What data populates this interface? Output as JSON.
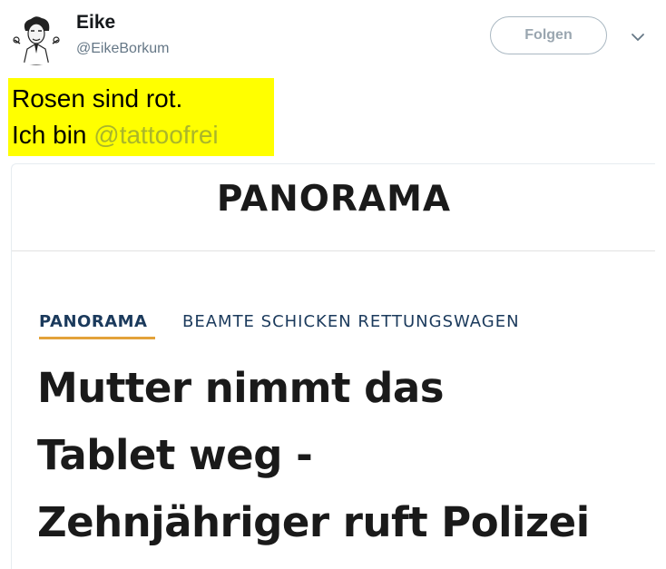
{
  "user": {
    "display_name": "Eike",
    "handle": "@EikeBorkum",
    "avatar_icon": "cartoon-avatar-icon"
  },
  "follow_label": "Folgen",
  "tweet": {
    "line1": "Rosen sind rot.",
    "line2_prefix": "Ich bin ",
    "mention": "@tattoofrei",
    "highlight_color": "#ffff00"
  },
  "card": {
    "logo": "PANORAMA",
    "section": "PANORAMA",
    "kicker": "BEAMTE SCHICKEN RETTUNGSWAGEN",
    "headline_lines": [
      "Mutter nimmt das",
      "Tablet weg -",
      "Zehnjähriger ruft Polizei"
    ]
  },
  "colors": {
    "section_accent": "#e3a23a",
    "section_text": "#1b3a5c",
    "mention": "#aab62a"
  }
}
